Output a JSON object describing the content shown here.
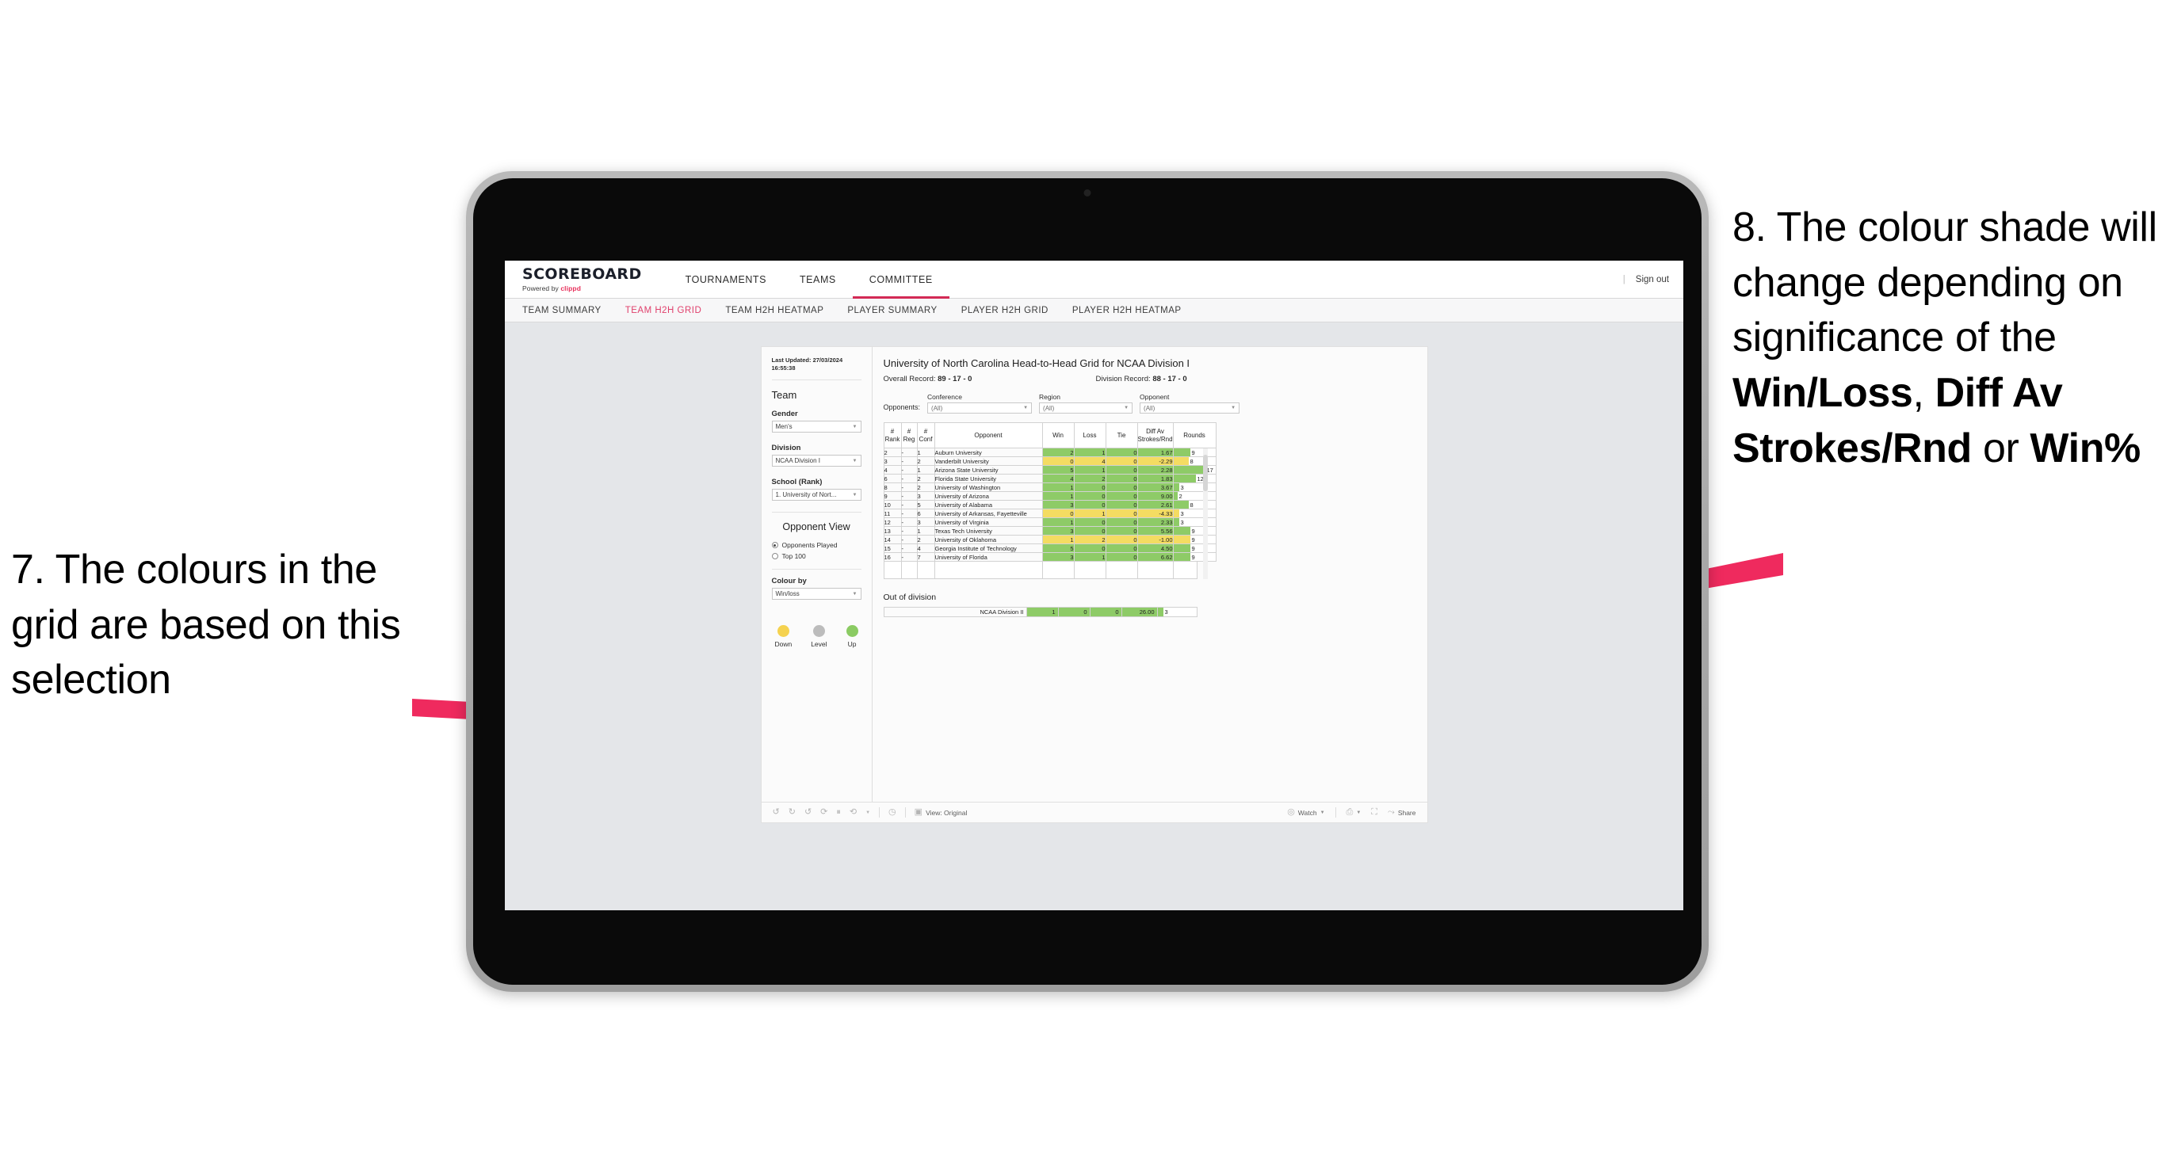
{
  "annotations": {
    "left": {
      "id": "7.",
      "text": "7. The colours in the grid are based on this selection"
    },
    "right": {
      "id": "8.",
      "line1": "8. The colour shade will change depending on significance of the ",
      "bold1": "Win/Loss",
      "mid1": ", ",
      "bold2": "Diff Av Strokes/Rnd",
      "mid2": " or ",
      "bold3": "Win%"
    },
    "arrow_color": "#ef2a5e"
  },
  "topnav": {
    "brand_title": "SCOREBOARD",
    "brand_sub_prefix": "Powered by ",
    "brand_sub_name": "clippd",
    "items": [
      {
        "label": "TOURNAMENTS",
        "active": false
      },
      {
        "label": "TEAMS",
        "active": false
      },
      {
        "label": "COMMITTEE",
        "active": true
      }
    ],
    "divider": "|",
    "signout": "Sign out"
  },
  "subnav": {
    "items": [
      {
        "label": "TEAM SUMMARY",
        "active": false
      },
      {
        "label": "TEAM H2H GRID",
        "active": true
      },
      {
        "label": "TEAM H2H HEATMAP",
        "active": false
      },
      {
        "label": "PLAYER SUMMARY",
        "active": false
      },
      {
        "label": "PLAYER H2H GRID",
        "active": false
      },
      {
        "label": "PLAYER H2H HEATMAP",
        "active": false
      }
    ]
  },
  "panel": {
    "last_updated": "Last Updated: 27/03/2024 16:55:38",
    "team_heading": "Team",
    "gender_label": "Gender",
    "gender_value": "Men's",
    "division_label": "Division",
    "division_value": "NCAA Division I",
    "school_label": "School (Rank)",
    "school_value": "1. University of Nort...",
    "opponent_view_heading": "Opponent View",
    "opponent_view_options": [
      {
        "label": "Opponents Played",
        "selected": true
      },
      {
        "label": "Top 100",
        "selected": false
      }
    ],
    "colour_by_label": "Colour by",
    "colour_by_value": "Win/loss",
    "legend": [
      {
        "label": "Down",
        "color": "#f5d24f"
      },
      {
        "label": "Level",
        "color": "#bcbcbc"
      },
      {
        "label": "Up",
        "color": "#8bcb63"
      }
    ]
  },
  "main": {
    "title": "University of North Carolina Head-to-Head Grid for NCAA Division I",
    "overall_record_label": "Overall Record: ",
    "overall_record_value": "89 - 17 - 0",
    "division_record_label": "Division Record: ",
    "division_record_value": "88 - 17 - 0",
    "opponents_label": "Opponents:",
    "filters": [
      {
        "label": "Conference",
        "value": "(All)"
      },
      {
        "label": "Region",
        "value": "(All)"
      },
      {
        "label": "Opponent",
        "value": "(All)"
      }
    ],
    "out_of_division_title": "Out of division"
  },
  "chart_data": {
    "type": "table",
    "title": "University of North Carolina Head-to-Head Grid for NCAA Division I",
    "columns": [
      "# Rank",
      "# Reg",
      "# Conf",
      "Opponent",
      "Win",
      "Loss",
      "Tie",
      "Diff Av Strokes/Rnd",
      "Rounds"
    ],
    "column_header_lines": [
      [
        "#",
        "Rank"
      ],
      [
        "#",
        "Reg"
      ],
      [
        "#",
        "Conf"
      ],
      [
        "Opponent",
        ""
      ],
      [
        "Win",
        ""
      ],
      [
        "Loss",
        ""
      ],
      [
        "Tie",
        ""
      ],
      [
        "Diff Av",
        "Strokes/Rnd"
      ],
      [
        "Rounds",
        ""
      ]
    ],
    "rounds_max": 17,
    "colors": {
      "up": "#8ecb67",
      "down": "#f4dc62",
      "level": "#bcbcbc"
    },
    "rows": [
      {
        "rank": "2",
        "reg": "-",
        "conf": "1",
        "opponent": "Auburn University",
        "win": "2",
        "loss": "1",
        "tie": "0",
        "diff": "1.67",
        "rounds": "9",
        "rounds_n": 9,
        "state": "up"
      },
      {
        "rank": "3",
        "reg": "-",
        "conf": "2",
        "opponent": "Vanderbilt University",
        "win": "0",
        "loss": "4",
        "tie": "0",
        "diff": "-2.29",
        "rounds": "8",
        "rounds_n": 8,
        "state": "down"
      },
      {
        "rank": "4",
        "reg": "-",
        "conf": "1",
        "opponent": "Arizona State University",
        "win": "5",
        "loss": "1",
        "tie": "0",
        "diff": "2.28",
        "rounds": "17",
        "rounds_n": 17,
        "state": "up"
      },
      {
        "rank": "6",
        "reg": "-",
        "conf": "2",
        "opponent": "Florida State University",
        "win": "4",
        "loss": "2",
        "tie": "0",
        "diff": "1.83",
        "rounds": "12",
        "rounds_n": 12,
        "state": "up"
      },
      {
        "rank": "8",
        "reg": "-",
        "conf": "2",
        "opponent": "University of Washington",
        "win": "1",
        "loss": "0",
        "tie": "0",
        "diff": "3.67",
        "rounds": "3",
        "rounds_n": 3,
        "state": "up"
      },
      {
        "rank": "9",
        "reg": "-",
        "conf": "3",
        "opponent": "University of Arizona",
        "win": "1",
        "loss": "0",
        "tie": "0",
        "diff": "9.00",
        "rounds": "2",
        "rounds_n": 2,
        "state": "up"
      },
      {
        "rank": "10",
        "reg": "-",
        "conf": "5",
        "opponent": "University of Alabama",
        "win": "3",
        "loss": "0",
        "tie": "0",
        "diff": "2.61",
        "rounds": "8",
        "rounds_n": 8,
        "state": "up"
      },
      {
        "rank": "11",
        "reg": "-",
        "conf": "6",
        "opponent": "University of Arkansas, Fayetteville",
        "win": "0",
        "loss": "1",
        "tie": "0",
        "diff": "-4.33",
        "rounds": "3",
        "rounds_n": 3,
        "state": "down"
      },
      {
        "rank": "12",
        "reg": "-",
        "conf": "3",
        "opponent": "University of Virginia",
        "win": "1",
        "loss": "0",
        "tie": "0",
        "diff": "2.33",
        "rounds": "3",
        "rounds_n": 3,
        "state": "up"
      },
      {
        "rank": "13",
        "reg": "-",
        "conf": "1",
        "opponent": "Texas Tech University",
        "win": "3",
        "loss": "0",
        "tie": "0",
        "diff": "5.56",
        "rounds": "9",
        "rounds_n": 9,
        "state": "up"
      },
      {
        "rank": "14",
        "reg": "-",
        "conf": "2",
        "opponent": "University of Oklahoma",
        "win": "1",
        "loss": "2",
        "tie": "0",
        "diff": "-1.00",
        "rounds": "9",
        "rounds_n": 9,
        "state": "down"
      },
      {
        "rank": "15",
        "reg": "-",
        "conf": "4",
        "opponent": "Georgia Institute of Technology",
        "win": "5",
        "loss": "0",
        "tie": "0",
        "diff": "4.50",
        "rounds": "9",
        "rounds_n": 9,
        "state": "up"
      },
      {
        "rank": "16",
        "reg": "-",
        "conf": "7",
        "opponent": "University of Florida",
        "win": "3",
        "loss": "1",
        "tie": "0",
        "diff": "6.62",
        "rounds": "9",
        "rounds_n": 9,
        "state": "up"
      }
    ],
    "out_of_division": [
      {
        "opponent": "NCAA Division II",
        "win": "1",
        "loss": "0",
        "tie": "0",
        "diff": "26.00",
        "rounds": "3",
        "rounds_n": 3,
        "state": "up"
      }
    ]
  },
  "toolbar": {
    "view_label": "View: Original",
    "watch_label": "Watch",
    "share_label": "Share",
    "icons": [
      "undo-icon",
      "redo-icon",
      "revert-icon",
      "refresh-icon",
      "pause-icon",
      "loop-icon",
      "chevron-down-icon",
      "clock-icon"
    ]
  }
}
